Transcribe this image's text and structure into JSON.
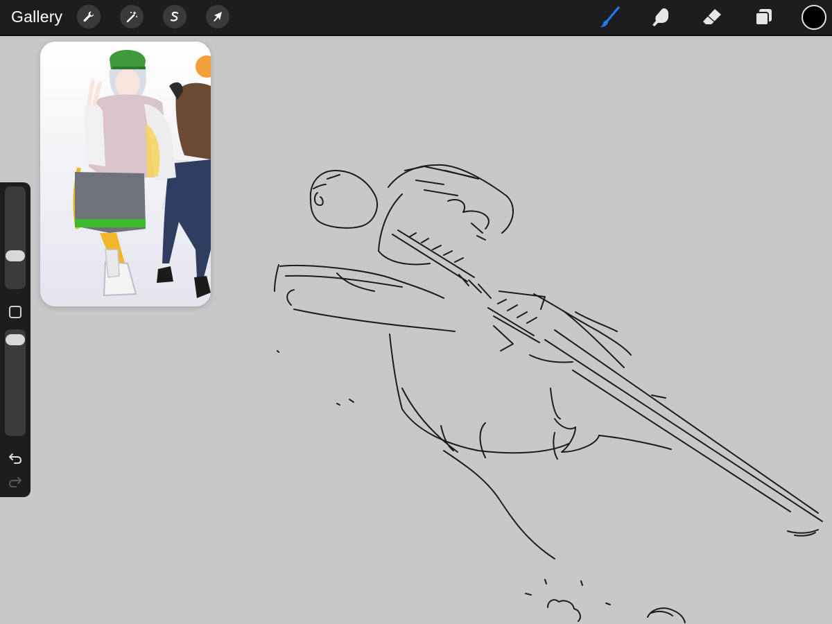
{
  "topbar": {
    "gallery_label": "Gallery",
    "left_tools": [
      {
        "name": "actions",
        "icon": "wrench-icon"
      },
      {
        "name": "adjustments",
        "icon": "magic-wand-icon"
      },
      {
        "name": "selection",
        "icon": "selection-s-icon"
      },
      {
        "name": "transform",
        "icon": "arrow-cursor-icon"
      }
    ],
    "right_tools": [
      {
        "name": "brush",
        "icon": "brush-icon",
        "active": true
      },
      {
        "name": "smudge",
        "icon": "smudge-finger-icon",
        "active": false
      },
      {
        "name": "eraser",
        "icon": "eraser-icon",
        "active": false
      },
      {
        "name": "layers",
        "icon": "layers-icon",
        "active": false
      }
    ],
    "current_color": "#000000"
  },
  "colors": {
    "topbar_bg": "#1d1d1f",
    "canvas_bg": "#c8c8ca",
    "active_tool": "#1e7cf2",
    "stroke": "#1a1a1a"
  },
  "reference": {
    "description_icon": "character-reference-image"
  },
  "sidebar": {
    "brush_size": 0.3,
    "opacity": 0.95,
    "modify_icon": "square-modify-icon",
    "undo_icon": "undo-icon",
    "redo_icon": "redo-icon"
  }
}
